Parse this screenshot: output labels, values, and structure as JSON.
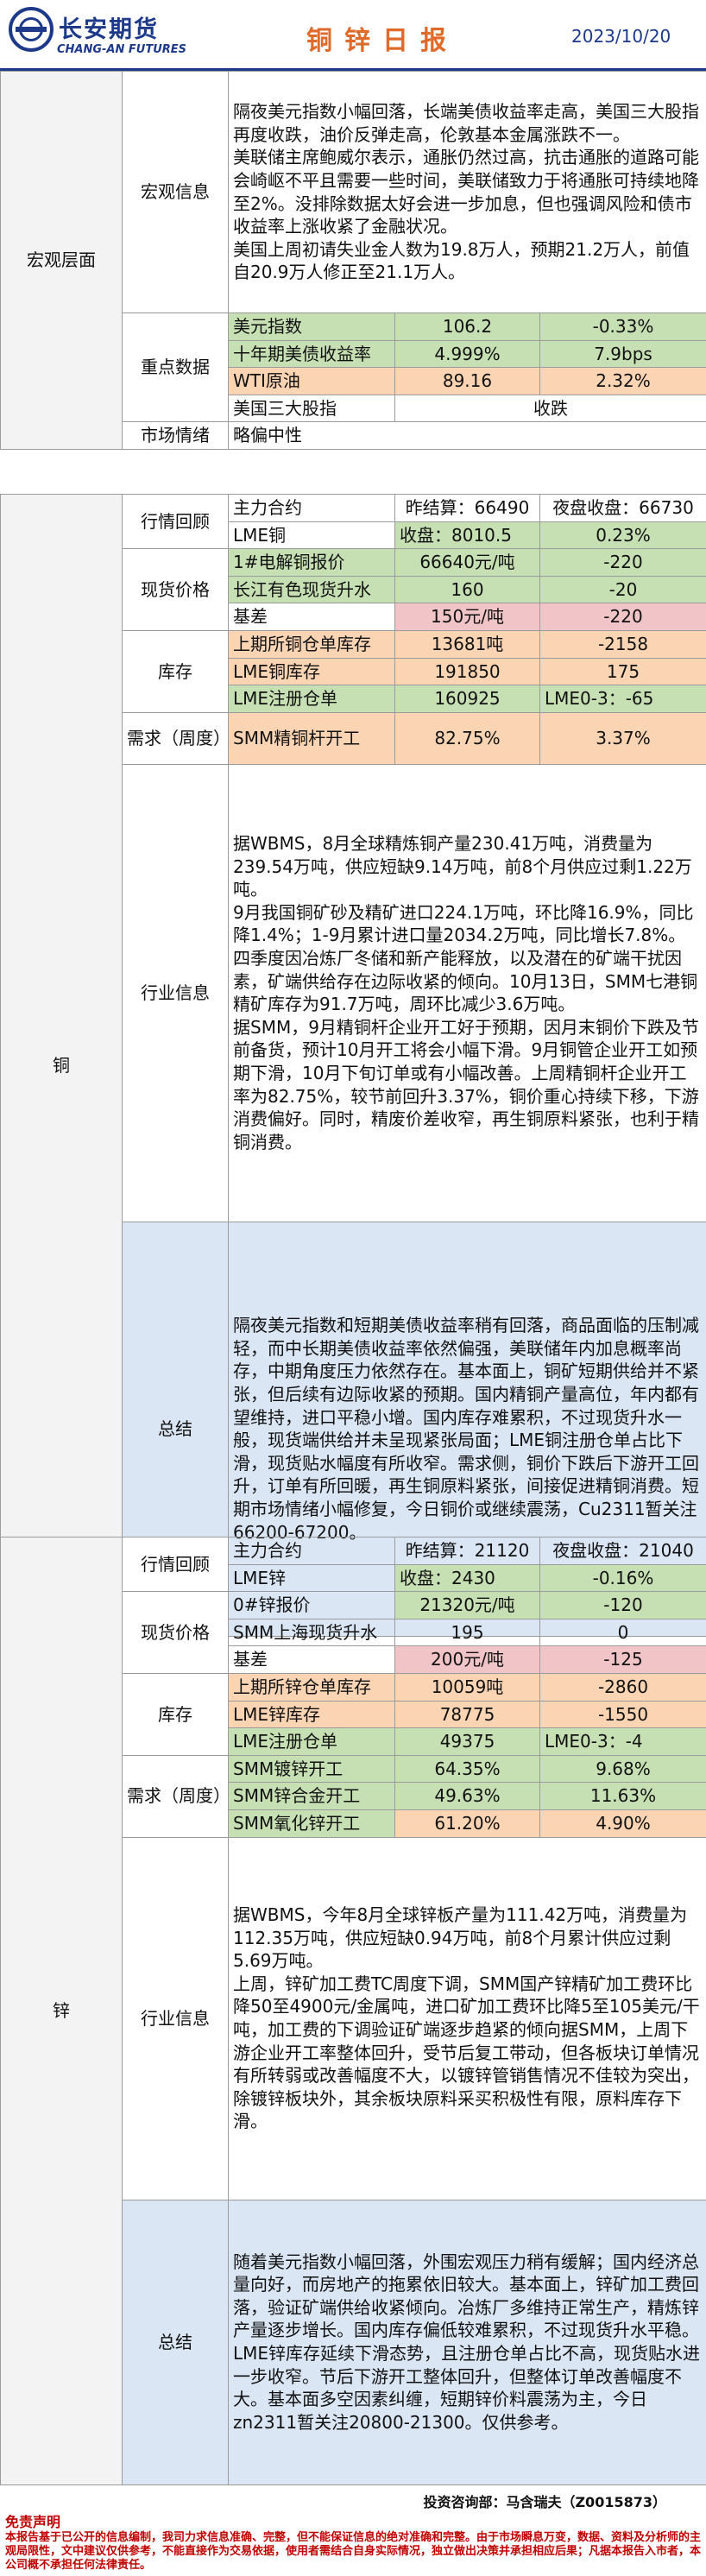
{
  "header": {
    "company_cn": "长安期货",
    "company_en": "CHANG-AN FUTURES",
    "title": "铜锌日报",
    "date": "2023/10/20"
  },
  "macro": {
    "section": "宏观层面",
    "info_label": "宏观信息",
    "info_paragraphs": [
      "隔夜美元指数小幅回落，长端美债收益率走高，美国三大股指再度收跌，油价反弹走高，伦敦基本金属涨跌不一。",
      "美联储主席鲍威尔表示，通胀仍然过高，抗击通胀的道路可能会崎岖不平且需要一些时间，美联储致力于将通胀可持续地降至2%。没排除数据太好会进一步加息，但也强调风险和债市收益率上涨收紧了金融状况。",
      "美国上周初请失业金人数为19.8万人，预期21.2万人，前值自20.9万人修正至21.1万人。"
    ],
    "key_label": "重点数据",
    "key_rows": [
      {
        "name": "美元指数",
        "value": "106.2",
        "change": "-0.33%"
      },
      {
        "name": "十年期美债收益率",
        "value": "4.999%",
        "change": "7.9bps"
      },
      {
        "name": "WTI原油",
        "value": "89.16",
        "change": "2.32%"
      },
      {
        "name": "美国三大股指",
        "value": "收跌"
      }
    ],
    "sentiment_label": "市场情绪",
    "sentiment_value": "略偏中性"
  },
  "copper": {
    "section": "铜",
    "review_label": "行情回顾",
    "review_rows": [
      {
        "a": "主力合约",
        "b": "昨结算：66490",
        "c": "夜盘收盘：66730"
      },
      {
        "a": "LME铜",
        "b": "收盘：8010.5",
        "c": "0.23%"
      }
    ],
    "spot_label": "现货价格",
    "spot_rows": [
      {
        "a": "1#电解铜报价",
        "b": "66640元/吨",
        "c": "-220"
      },
      {
        "a": "长江有色现货升水",
        "b": "160",
        "c": "-20"
      },
      {
        "a": "基差",
        "b": "150元/吨",
        "c": "-220"
      }
    ],
    "stock_label": "库存",
    "stock_rows": [
      {
        "a": "上期所铜仓单库存",
        "b": "13681吨",
        "c": "-2158"
      },
      {
        "a": "LME铜库存",
        "b": "191850",
        "c": "175"
      },
      {
        "a": "LME注册仓单",
        "b": "160925",
        "c": "LME0-3：-65"
      }
    ],
    "demand_label": "需求（周度）",
    "demand_rows": [
      {
        "a": "SMM精铜杆开工",
        "b": "82.75%",
        "c": "3.37%"
      }
    ],
    "industry_label": "行业信息",
    "industry_paragraphs": [
      "据WBMS，8月全球精炼铜产量230.41万吨，消费量为239.54万吨，供应短缺9.14万吨，前8个月供应过剩1.22万吨。",
      "9月我国铜矿砂及精矿进口224.1万吨，环比降16.9%，同比降1.4%；1-9月累计进口量2034.2万吨，同比增长7.8%。四季度因冶炼厂冬储和新产能释放，以及潜在的矿端干扰因素，矿端供给存在边际收紧的倾向。10月13日，SMM七港铜精矿库存为91.7万吨，周环比减少3.6万吨。",
      "据SMM，9月精铜杆企业开工好于预期，因月末铜价下跌及节前备货，预计10月开工将会小幅下滑。9月铜管企业开工如预期下滑，10月下旬订单或有小幅改善。上周精铜杆企业开工率为82.75%，较节前回升3.37%，铜价重心持续下移，下游消费偏好。同时，精废价差收窄，再生铜原料紧张，也利于精铜消费。"
    ],
    "summary_label": "总结",
    "summary_text": "隔夜美元指数和短期美债收益率稍有回落，商品面临的压制减轻，而中长期美债收益率依然偏强，美联储年内加息概率尚存，中期角度压力依然存在。基本面上，铜矿短期供给并不紧张，但后续有边际收紧的预期。国内精铜产量高位，年内都有望维持，进口平稳小增。国内库存难累积，不过现货升水一般，现货端供给并未呈现紧张局面；LME铜注册仓单占比下滑，现货贴水幅度有所收窄。需求侧，铜价下跌后下游开工回升，订单有所回暖，再生铜原料紧张，间接促进精铜消费。短期市场情绪小幅修复，今日铜价或继续震荡，Cu2311暂关注66200-67200。"
  },
  "zinc": {
    "section": "锌",
    "review_label": "行情回顾",
    "review_rows": [
      {
        "a": "主力合约",
        "b": "昨结算：21120",
        "c": "夜盘收盘：21040"
      },
      {
        "a": "LME锌",
        "b": "收盘：2430",
        "c": "-0.16%"
      }
    ],
    "spot_label": "现货价格",
    "spot_rows": [
      {
        "a": "0#锌报价",
        "b": "21320元/吨",
        "c": "-120"
      },
      {
        "a": "SMM上海现货升水",
        "b": "195",
        "c": "0"
      },
      {
        "a": "基差",
        "b": "200元/吨",
        "c": "-125"
      }
    ],
    "stock_label": "库存",
    "stock_rows": [
      {
        "a": "上期所锌仓单库存",
        "b": "10059吨",
        "c": "-2860"
      },
      {
        "a": "LME锌库存",
        "b": "78775",
        "c": "-1550"
      },
      {
        "a": "LME注册仓单",
        "b": "49375",
        "c": "LME0-3：-4"
      }
    ],
    "demand_label": "需求（周度）",
    "demand_rows": [
      {
        "a": "SMM镀锌开工",
        "b": "64.35%",
        "c": "9.68%"
      },
      {
        "a": "SMM锌合金开工",
        "b": "49.63%",
        "c": "11.63%"
      },
      {
        "a": "SMM氧化锌开工",
        "b": "61.20%",
        "c": "4.90%"
      }
    ],
    "industry_label": "行业信息",
    "industry_paragraphs": [
      "据WBMS，今年8月全球锌板产量为111.42万吨，消费量为112.35万吨，供应短缺0.94万吨，前8个月累计供应过剩5.69万吨。",
      "上周，锌矿加工费TC周度下调，SMM国产锌精矿加工费环比降50至4900元/金属吨，进口矿加工费环比降5至105美元/干吨，加工费的下调验证矿端逐步趋紧的倾向据SMM，上周下游企业开工率整体回升，受节后复工带动，但各板块订单情况有所转弱或改善幅度不大，以镀锌管销售情况不佳较为突出，除镀锌板块外，其余板块原料采买积极性有限，原料库存下滑。"
    ],
    "summary_label": "总结",
    "summary_text": "随着美元指数小幅回落，外围宏观压力稍有缓解；国内经济总量向好，而房地产的拖累依旧较大。基本面上，锌矿加工费回落，验证矿端供给收紧倾向。冶炼厂多维持正常生产，精炼锌产量逐步增长。国内库存偏低较难累积，不过现货升水平稳。LME锌库存延续下滑态势，且注册仓单占比不高，现货贴水进一步收窄。节后下游开工整体回升，但整体订单改善幅度不大。基本面多空因素纠缠，短期锌价料震荡为主，今日zn2311暂关注20800-21300。仅供参考。"
  },
  "footer": {
    "analyst": "投资咨询部：马含瑞夫（Z0015873）",
    "disclaimer_title": "免责声明",
    "disclaimer_text": "本报告基于已公开的信息编制，我司力求信息准确、完整，但不能保证信息的绝对准确和完整。由于市场瞬息万变，数据、资料及分析师的主观局限性，文中建议仅供参考，不能直接作为交易依据，使用者需结合自身实际情况，独立做出决策并承担相应后果；凡据本报告入市者，本公司概不承担任何法律责任。"
  },
  "colors": {
    "brand_blue": "#1d3a8a",
    "title_orange": "#e06a2a",
    "green_cell": "#c6e0b4",
    "orange_cell": "#fbd4b4",
    "pink_cell": "#f1c4c8",
    "summary_blue": "#dbe6f5",
    "disclaimer_red": "#c00000"
  }
}
